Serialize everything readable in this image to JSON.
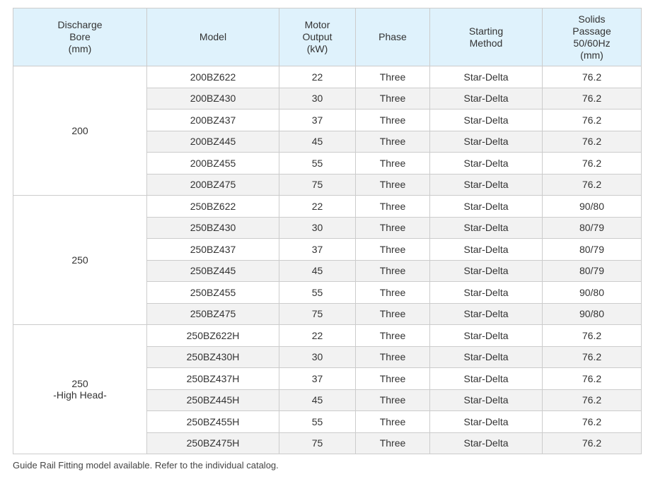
{
  "table": {
    "headers": [
      {
        "key": "bore",
        "lines": [
          "Discharge",
          "Bore",
          "(mm)"
        ]
      },
      {
        "key": "model",
        "lines": [
          "Model"
        ]
      },
      {
        "key": "output",
        "lines": [
          "Motor",
          "Output",
          "(kW)"
        ]
      },
      {
        "key": "phase",
        "lines": [
          "Phase"
        ]
      },
      {
        "key": "starting",
        "lines": [
          "Starting",
          "Method"
        ]
      },
      {
        "key": "solids",
        "lines": [
          "Solids",
          "Passage",
          "50/60Hz",
          "(mm)"
        ]
      }
    ],
    "groups": [
      {
        "bore_lines": [
          "200"
        ],
        "rows": [
          {
            "model": "200BZ622",
            "output": "22",
            "phase": "Three",
            "starting": "Star-Delta",
            "solids": "76.2"
          },
          {
            "model": "200BZ430",
            "output": "30",
            "phase": "Three",
            "starting": "Star-Delta",
            "solids": "76.2"
          },
          {
            "model": "200BZ437",
            "output": "37",
            "phase": "Three",
            "starting": "Star-Delta",
            "solids": "76.2"
          },
          {
            "model": "200BZ445",
            "output": "45",
            "phase": "Three",
            "starting": "Star-Delta",
            "solids": "76.2"
          },
          {
            "model": "200BZ455",
            "output": "55",
            "phase": "Three",
            "starting": "Star-Delta",
            "solids": "76.2"
          },
          {
            "model": "200BZ475",
            "output": "75",
            "phase": "Three",
            "starting": "Star-Delta",
            "solids": "76.2"
          }
        ]
      },
      {
        "bore_lines": [
          "250"
        ],
        "rows": [
          {
            "model": "250BZ622",
            "output": "22",
            "phase": "Three",
            "starting": "Star-Delta",
            "solids": "90/80"
          },
          {
            "model": "250BZ430",
            "output": "30",
            "phase": "Three",
            "starting": "Star-Delta",
            "solids": "80/79"
          },
          {
            "model": "250BZ437",
            "output": "37",
            "phase": "Three",
            "starting": "Star-Delta",
            "solids": "80/79"
          },
          {
            "model": "250BZ445",
            "output": "45",
            "phase": "Three",
            "starting": "Star-Delta",
            "solids": "80/79"
          },
          {
            "model": "250BZ455",
            "output": "55",
            "phase": "Three",
            "starting": "Star-Delta",
            "solids": "90/80"
          },
          {
            "model": "250BZ475",
            "output": "75",
            "phase": "Three",
            "starting": "Star-Delta",
            "solids": "90/80"
          }
        ]
      },
      {
        "bore_lines": [
          "250",
          "-High Head-"
        ],
        "rows": [
          {
            "model": "250BZ622H",
            "output": "22",
            "phase": "Three",
            "starting": "Star-Delta",
            "solids": "76.2"
          },
          {
            "model": "250BZ430H",
            "output": "30",
            "phase": "Three",
            "starting": "Star-Delta",
            "solids": "76.2"
          },
          {
            "model": "250BZ437H",
            "output": "37",
            "phase": "Three",
            "starting": "Star-Delta",
            "solids": "76.2"
          },
          {
            "model": "250BZ445H",
            "output": "45",
            "phase": "Three",
            "starting": "Star-Delta",
            "solids": "76.2"
          },
          {
            "model": "250BZ455H",
            "output": "55",
            "phase": "Three",
            "starting": "Star-Delta",
            "solids": "76.2"
          },
          {
            "model": "250BZ475H",
            "output": "75",
            "phase": "Three",
            "starting": "Star-Delta",
            "solids": "76.2"
          }
        ]
      }
    ]
  },
  "footnote": "Guide Rail Fitting model available. Refer to the individual catalog.",
  "colors": {
    "header_bg": "#dff2fc",
    "alt_row_bg": "#f2f2f2",
    "border": "#cccccc",
    "text": "#333333"
  }
}
